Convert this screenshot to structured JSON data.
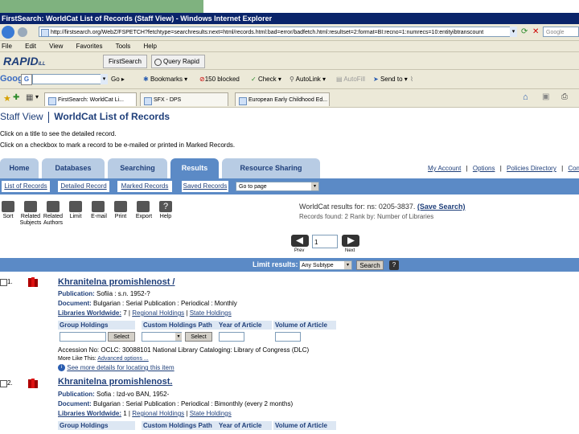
{
  "window": {
    "title": "FirstSearch: WorldCat List of Records (Staff View) - Windows Internet Explorer"
  },
  "address": {
    "url": "http://firstsearch.org/WebZ/FSPETCH?fetchtype=searchresults:next=html/records.html:bad=error/badfetch.html:resultset=2:format=BI:recno=1:numrecs=10:entityibtranscount",
    "search_text": "Google"
  },
  "menu": [
    "File",
    "Edit",
    "View",
    "Favorites",
    "Tools",
    "Help"
  ],
  "toolbar2": {
    "brand": "RAPID",
    "brand_sub": "ILL",
    "firstsearch": "FirstSearch",
    "query_rapid": "Query Rapid"
  },
  "google_bar": {
    "logo": "Google",
    "go": "Go",
    "bookmarks": "Bookmarks",
    "blocked": "150 blocked",
    "check": "Check",
    "autolink": "AutoLink",
    "autofill": "AutoFill",
    "sendto": "Send to"
  },
  "browser_tabs": [
    "FirstSearch: WorldCat Li...",
    "SFX - DPS",
    "European Early Childhood Ed..."
  ],
  "page": {
    "staff_view": "Staff View",
    "heading": "WorldCat List of Records",
    "instruction1": "Click on a title to see the detailed record.",
    "instruction2": "Click on a checkbox to mark a record to be e-mailed or printed in Marked Records."
  },
  "nav_tabs": [
    "Home",
    "Databases",
    "Searching",
    "Results",
    "Resource Sharing"
  ],
  "top_links": [
    "My Account",
    "Options",
    "Policies Directory",
    "Comments"
  ],
  "sub_tabs": [
    "List of Records",
    "Detailed Record",
    "Marked Records",
    "Saved Records"
  ],
  "goto_select": "Go to page",
  "tools": [
    "Sort",
    "Related Subjects",
    "Related Authors",
    "Limit",
    "E-mail",
    "Print",
    "Export",
    "Help"
  ],
  "results_info": {
    "label": "WorldCat results for: ns: 0205-3837.",
    "save_search": "(Save Search)",
    "records_found": "Records found: 2  Rank by: Number of Libraries"
  },
  "pager": {
    "prev": "Prev",
    "next": "Next",
    "page_value": "1"
  },
  "limit": {
    "label": "Limit results:",
    "select": "Any Subtype",
    "search_button": "Search",
    "help": "?"
  },
  "records": [
    {
      "num": "1.",
      "title": "Khranitelna promishlenost /",
      "publication_label": "Publication:",
      "publication": "Sofiia : s.n. 1952-?",
      "document_label": "Document:",
      "document": "Bulgarian : Serial Publication : Periodical : Monthly",
      "libraries": "Libraries Worldwide:",
      "libraries_count": "7",
      "regional": "Regional Holdings",
      "state": "State Holdings",
      "cols": [
        "Group Holdings",
        "Custom Holdings Path",
        "Year of Article",
        "Volume of Article"
      ],
      "select1": "Select",
      "select2": "Select",
      "accession": "Accession No: OCLC: 30088101 National Library Cataloging: Library of Congress (DLC)",
      "more_like": "More Like This:",
      "advanced": "Advanced options ...",
      "see_more": "See more details for locating this item"
    },
    {
      "num": "2.",
      "title": "Khranitelna promishlenost.",
      "publication_label": "Publication:",
      "publication": "Sofia : Izd-vo BAN, 1952-",
      "document_label": "Document:",
      "document": "Bulgarian : Serial Publication : Periodical : Bimonthly (every 2 months)",
      "libraries": "Libraries Worldwide:",
      "libraries_count": "1",
      "regional": "Regional Holdings",
      "state": "State Holdings",
      "cols": [
        "Group Holdings",
        "Custom Holdings Path",
        "Year of Article",
        "Volume of Article"
      ]
    }
  ]
}
